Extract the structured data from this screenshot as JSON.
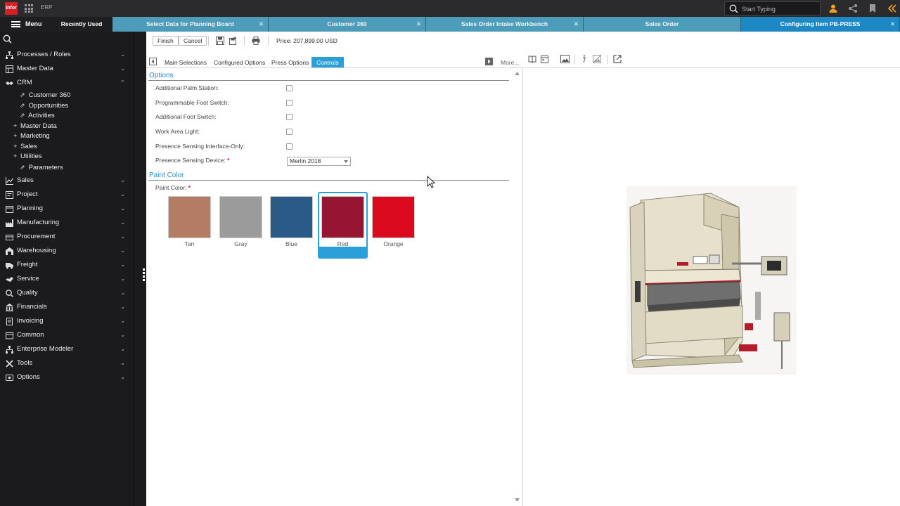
{
  "topbar": {
    "logo_text": "infor",
    "app_name": "ERP",
    "search_placeholder": "Start Typing"
  },
  "tabbar": {
    "menu_label": "Menu",
    "recent_label": "Recently Used",
    "tabs": [
      {
        "label": "Select Data for Planning Board",
        "closable": true
      },
      {
        "label": "Customer 360",
        "closable": true
      },
      {
        "label": "Sales Order Intake Workbench",
        "closable": true
      },
      {
        "label": "Sales Order",
        "closable": false
      },
      {
        "label": "Configuring Item PB-PRESS",
        "closable": true,
        "active": true
      }
    ]
  },
  "sidebar": {
    "items": [
      {
        "label": "Processes / Roles",
        "icon": "hierarchy-icon"
      },
      {
        "label": "Master Data",
        "icon": "database-icon"
      },
      {
        "label": "CRM",
        "icon": "handshake-icon",
        "expanded": true
      },
      {
        "label": "Sales",
        "icon": "chart-line-icon"
      },
      {
        "label": "Project",
        "icon": "project-icon"
      },
      {
        "label": "Planning",
        "icon": "planning-icon"
      },
      {
        "label": "Manufacturing",
        "icon": "factory-icon"
      },
      {
        "label": "Procurement",
        "icon": "cart-icon"
      },
      {
        "label": "Warehousing",
        "icon": "warehouse-icon"
      },
      {
        "label": "Freight",
        "icon": "truck-icon"
      },
      {
        "label": "Service",
        "icon": "service-icon"
      },
      {
        "label": "Quality",
        "icon": "quality-icon"
      },
      {
        "label": "Financials",
        "icon": "bank-icon"
      },
      {
        "label": "Invoicing",
        "icon": "invoice-icon"
      },
      {
        "label": "Common",
        "icon": "folder-icon"
      },
      {
        "label": "Enterprise Modeler",
        "icon": "model-icon"
      },
      {
        "label": "Tools",
        "icon": "tools-icon"
      },
      {
        "label": "Options",
        "icon": "options-icon"
      }
    ],
    "crm_children": [
      {
        "label": "Customer 360",
        "kind": "link"
      },
      {
        "label": "Opportunities",
        "kind": "link"
      },
      {
        "label": "Activities",
        "kind": "link"
      },
      {
        "label": "Master Data",
        "kind": "group"
      },
      {
        "label": "Marketing",
        "kind": "group"
      },
      {
        "label": "Sales",
        "kind": "group"
      },
      {
        "label": "Utilities",
        "kind": "group"
      },
      {
        "label": "Parameters",
        "kind": "link"
      }
    ]
  },
  "toolbar": {
    "finish_label": "Finish",
    "cancel_label": "Cancel",
    "price_text": "Price: 207,899.00 USD"
  },
  "panel_tabs": {
    "tabs": [
      "Main Selections",
      "Configured Options",
      "Press Options",
      "Controls"
    ],
    "active": "Controls",
    "more_label": "More..."
  },
  "options_section": {
    "title": "Options",
    "fields": [
      {
        "label": "Additional Palm Station:",
        "checked": false
      },
      {
        "label": "Programmable Foot Switch:",
        "checked": false
      },
      {
        "label": "Additional Foot Switch:",
        "checked": false
      },
      {
        "label": "Work Area Light:",
        "checked": false
      },
      {
        "label": "Presence Sensing Interface-Only:",
        "checked": false
      }
    ],
    "device_label": "Presence Sensing Device:",
    "device_value": "Merlin 2018"
  },
  "paint_section": {
    "title": "Paint Color",
    "field_label": "Paint Color:",
    "swatches": [
      {
        "label": "Tan",
        "color": "#b57c65"
      },
      {
        "label": "Gray",
        "color": "#9b9b9b"
      },
      {
        "label": "Blue",
        "color": "#2a5a88"
      },
      {
        "label": "Red",
        "color": "#961530"
      },
      {
        "label": "Orange",
        "color": "#dc0a1e"
      }
    ],
    "selected": "Red"
  },
  "colors": {
    "accent": "#2a9fd8",
    "tab_blue": "#4c9cba",
    "required": "#d81f26",
    "top_icon_orange": "#f0a020"
  }
}
